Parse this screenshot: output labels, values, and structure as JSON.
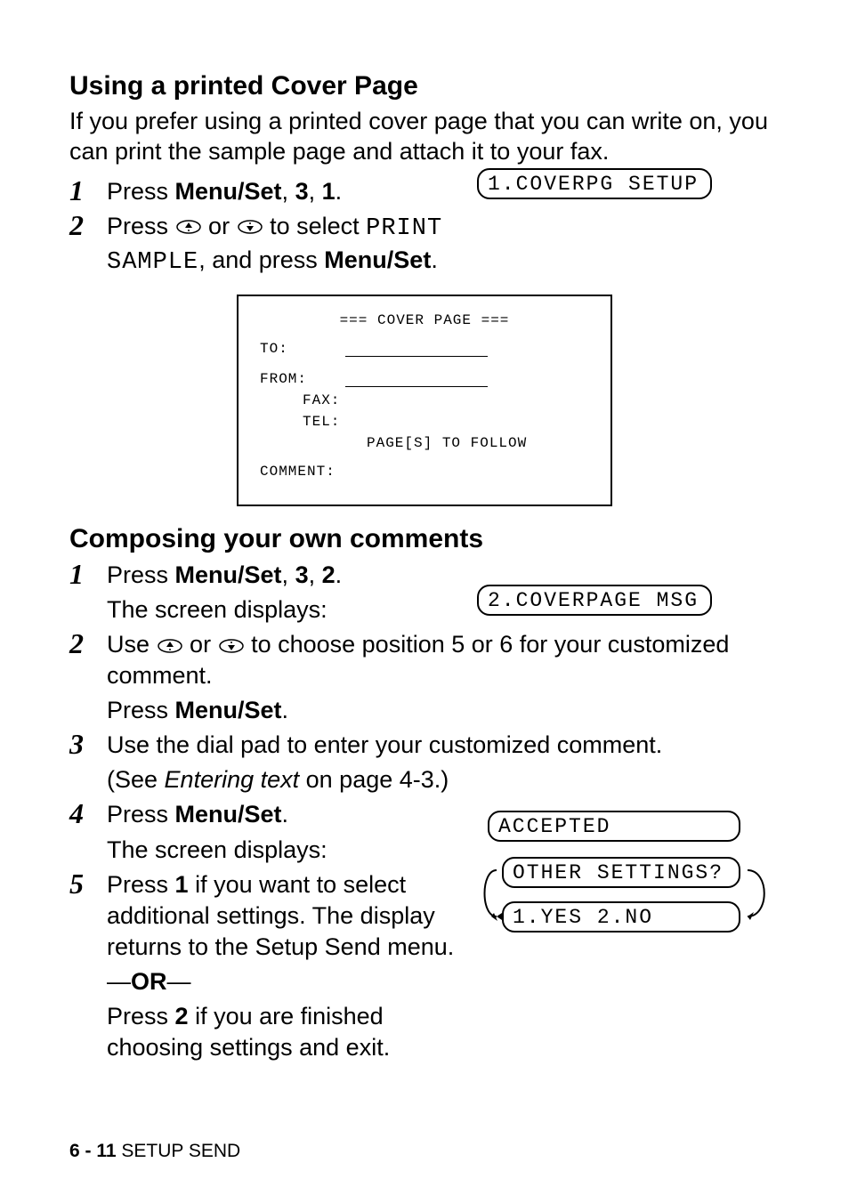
{
  "section1": {
    "heading": "Using a printed Cover Page",
    "intro": "If you prefer using a printed cover page that you can write on, you can print the sample page and attach it to your fax.",
    "step1_pre": "Press ",
    "step1_keys1": "Menu/Set",
    "step1_sep1": ", ",
    "step1_keys2": "3",
    "step1_sep2": ", ",
    "step1_keys3": "1",
    "step1_dot": ".",
    "step2_pre": "Press ",
    "step2_mid": " or ",
    "step2_post1": " to select ",
    "step2_mono1": "PRINT",
    "step2_mono2": "SAMPLE",
    "step2_post2": ", and press ",
    "step2_keys": "Menu/Set",
    "step2_dot": ".",
    "lcd1": "1.COVERPG SETUP"
  },
  "cover": {
    "title": "=== COVER PAGE ===",
    "to": "TO:",
    "from": "FROM:",
    "fax": "FAX:",
    "tel": "TEL:",
    "follow": "PAGE[S] TO FOLLOW",
    "comment": "COMMENT:"
  },
  "section2": {
    "heading": "Composing your own comments",
    "s1_pre": "Press ",
    "s1_keys1": "Menu/Set",
    "s1_sep1": ", ",
    "s1_keys2": "3",
    "s1_sep2": ", ",
    "s1_keys3": "2",
    "s1_dot": ".",
    "s1_disp": "The screen displays:",
    "lcd2": "2.COVERPAGE MSG",
    "s2_pre": "Use ",
    "s2_mid": " or ",
    "s2_post": " to choose position 5 or 6 for your customized comment.",
    "s2_press": "Press ",
    "s2_keys": "Menu/Set",
    "s2_dot": ".",
    "s3": "Use the dial pad to enter your customized comment.",
    "s3_see_pre": "(See ",
    "s3_see_link": "Entering text",
    "s3_see_post": " on page 4-3.)",
    "s4_pre": "Press ",
    "s4_keys": "Menu/Set",
    "s4_dot": ".",
    "s4_disp": "The screen displays:",
    "lcd_accepted": "ACCEPTED",
    "lcd_other": "OTHER SETTINGS?",
    "lcd_yesno": "1.YES 2.NO",
    "s5_pre": "Press ",
    "s5_key1": "1",
    "s5_mid": " if you want to select additional settings. The display returns to the Setup Send menu.",
    "or_dash1": "—",
    "or": "OR",
    "or_dash2": "—",
    "s5b_pre": "Press ",
    "s5b_key2": "2",
    "s5b_post": " if you are finished choosing settings and exit."
  },
  "footer": {
    "page": "6 - 11",
    "section": "   SETUP SEND"
  }
}
